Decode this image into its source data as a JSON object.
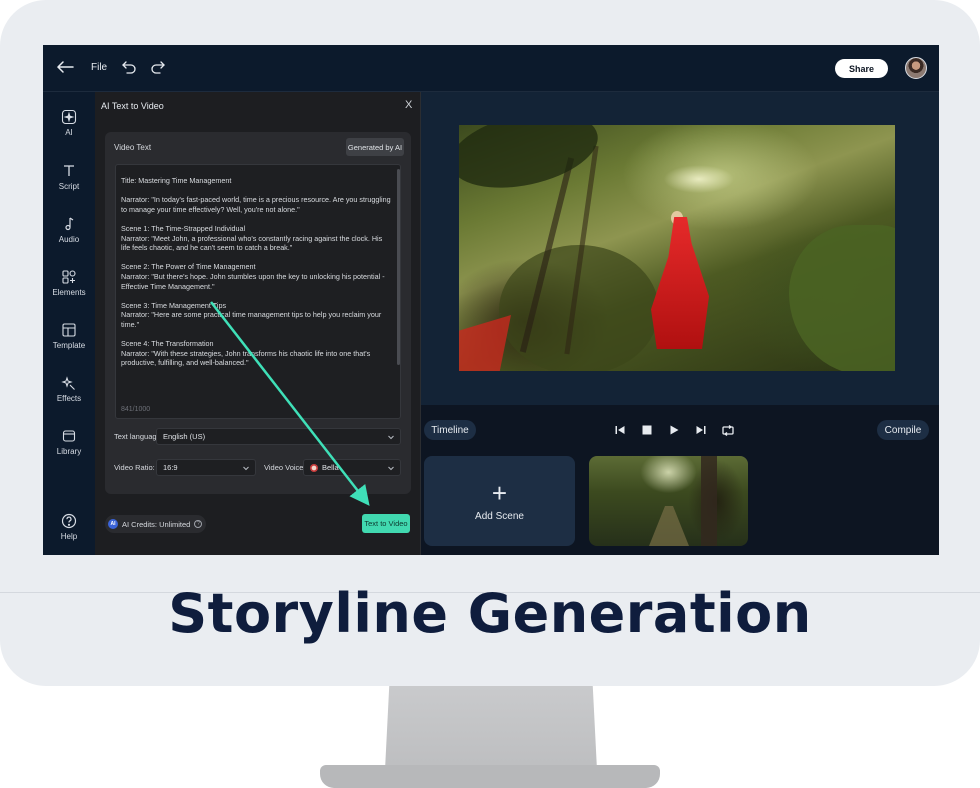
{
  "topbar": {
    "file_label": "File",
    "share_label": "Share"
  },
  "rail": {
    "items": [
      {
        "label": "AI",
        "icon": "ai-sparkle-icon"
      },
      {
        "label": "Script",
        "icon": "text-icon"
      },
      {
        "label": "Audio",
        "icon": "music-note-icon"
      },
      {
        "label": "Elements",
        "icon": "elements-grid-icon"
      },
      {
        "label": "Template",
        "icon": "template-icon"
      },
      {
        "label": "Effects",
        "icon": "effects-icon"
      },
      {
        "label": "Library",
        "icon": "library-icon"
      },
      {
        "label": "Help",
        "icon": "help-circle-icon"
      }
    ]
  },
  "panel": {
    "title": "AI Text to Video",
    "close": "X",
    "video_text_label": "Video Text",
    "generated_by_ai": "Generated by AI",
    "script": "Title: Mastering Time Management\n\nNarrator: \"In today's fast-paced world, time is a precious resource. Are you struggling to manage your time effectively? Well, you're not alone.\"\n\nScene 1: The Time-Strapped Individual\nNarrator: \"Meet John, a professional who's constantly racing against the clock. His life feels chaotic, and he can't seem to catch a break.\"\n\nScene 2: The Power of Time Management\nNarrator: \"But there's hope. John stumbles upon the key to unlocking his potential - Effective Time Management.\"\n\nScene 3: Time Management Tips\nNarrator: \"Here are some practical time management tips to help you reclaim your time.\"\n\nScene 4: The Transformation\nNarrator: \"With these strategies, John transforms his chaotic life into one that's productive, fulfilling, and well-balanced.\"",
    "char_count": "841/1000",
    "text_language_label": "Text language:",
    "text_language_value": "English (US)",
    "video_ratio_label": "Video Ratio:",
    "video_ratio_value": "16:9",
    "video_voice_label": "Video Voice:",
    "video_voice_value": "Bella",
    "credits": "AI Credits: Unlimited",
    "text_to_video_button": "Text to Video"
  },
  "editor": {
    "timeline_label": "Timeline",
    "compile_label": "Compile",
    "add_scene_plus": "+",
    "add_scene_label": "Add Scene"
  },
  "caption": "Storyline Generation",
  "colors": {
    "accent": "#41d9b0",
    "screen_bg": "#0d1522",
    "caption_text": "#0f1d3d"
  }
}
